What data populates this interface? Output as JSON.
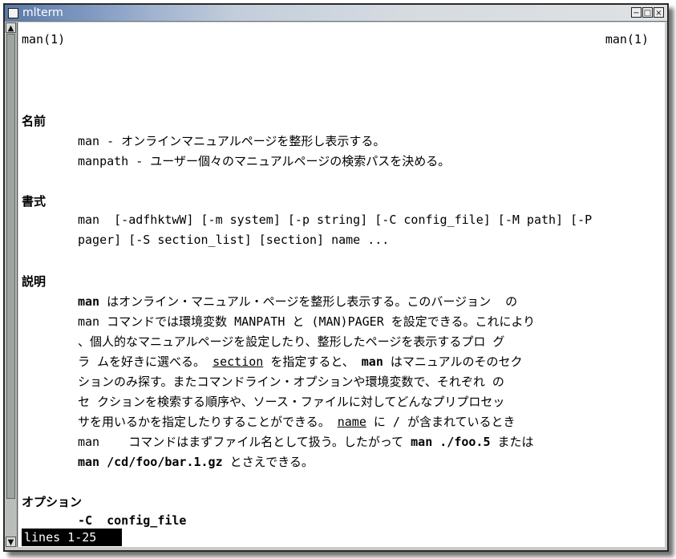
{
  "window": {
    "title": "mlterm",
    "buttons": {
      "minimize": "−",
      "maximize": "□",
      "close": "×"
    }
  },
  "scrollbar": {
    "up": "▲",
    "down": "▼"
  },
  "terminal": {
    "header_left": "man(1)",
    "header_right": "man(1)",
    "name_heading": "名前",
    "name_line1": "man - オンラインマニュアルページを整形し表示する。",
    "name_line2": "manpath - ユーザー個々のマニュアルページの検索パスを決める。",
    "synopsis_heading": "書式",
    "synopsis_line1": "man  [-adfhktwW] [-m system] [-p string] [-C config_file] [-M path] [-P",
    "synopsis_line2": "pager] [-S section_list] [section] name ...",
    "desc_heading": "説明",
    "desc_line1_a": "man",
    "desc_line1_b": " はオンライン・マニュアル・ページを整形し表示する。このバージョン  の",
    "desc_line2": "man コマンドでは環境変数 MANPATH と (MAN)PAGER を設定できる。これにより",
    "desc_line3": "、個人的なマニュアルページを設定したり、整形したページを表示するプロ グ",
    "desc_line4_a": "ラ ムを好きに選べる。 ",
    "desc_line4_b": "section",
    "desc_line4_c": " を指定すると、 ",
    "desc_line4_d": "man",
    "desc_line4_e": " はマニュアルのそのセク",
    "desc_line5": "ションのみ探す。またコマンドライン・オプションや環境変数で、それぞれ の",
    "desc_line6": "セ クションを検索する順序や、ソース・ファイルに対してどんなプリプロセッ",
    "desc_line7_a": "サを用いるかを指定したりすることができる。 ",
    "desc_line7_b": "name",
    "desc_line7_c": " に / が含まれているとき",
    "desc_line8_a": "man    コマンドはまずファイル名として扱う。したがって ",
    "desc_line8_b": "man ./foo.5",
    "desc_line8_c": " または",
    "desc_line9_a": "man /cd/foo/bar.1.gz",
    "desc_line9_b": " とさえできる。",
    "options_heading": "オプション",
    "option_c": "-C  config_file",
    "status": "lines 1-25"
  }
}
